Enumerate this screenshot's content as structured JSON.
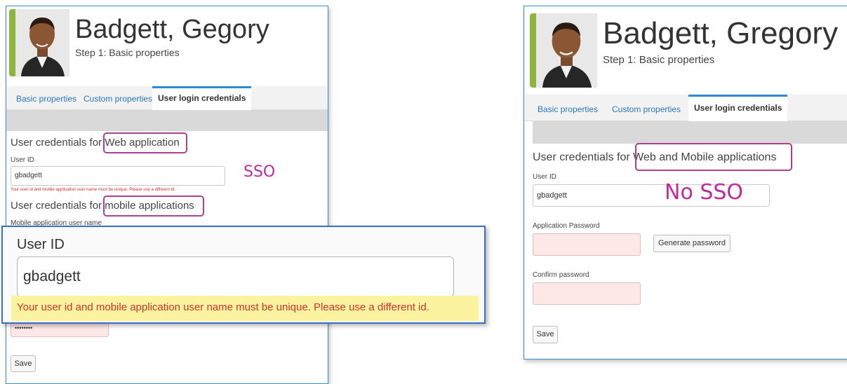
{
  "left_panel": {
    "name": "Badgett, Gegory",
    "step": "Step 1: Basic properties",
    "tabs": [
      "Basic properties",
      "Custom properties",
      "User login credentials"
    ],
    "web_section_prefix": "User credentials for",
    "web_section_highlight": "Web application",
    "user_id_label": "User ID",
    "user_id_value": "gbadgett",
    "error_text": "Your user id and mobile application user name must be unique. Please use a different id.",
    "mobile_section_prefix": "User credentials for",
    "mobile_section_highlight": "mobile applications",
    "mobile_user_label": "Mobile application user name",
    "password_value": "••••••••",
    "save_label": "Save",
    "annotation": "SSO"
  },
  "zoom_callout": {
    "user_id_label": "User ID",
    "user_id_value": "gbadgett",
    "error_text": "Your user id and mobile application user name must be unique. Please use a different id."
  },
  "right_panel": {
    "name": "Badgett, Gregory",
    "step": "Step 1: Basic properties",
    "tabs": [
      "Basic properties",
      "Custom properties",
      "User login credentials"
    ],
    "section_prefix": "User credentials for",
    "section_highlight": "Web and Mobile applications",
    "user_id_label": "User ID",
    "user_id_value": "gbadgett",
    "app_password_label": "Application Password",
    "generate_label": "Generate password",
    "confirm_label": "Confirm password",
    "save_label": "Save",
    "annotation": "No SSO"
  },
  "colors": {
    "accent_blue": "#2b8ad2",
    "highlight_purple": "#b0408f",
    "error_red": "#d0332d",
    "annotation_magenta": "#c02a9b",
    "error_highlight_yellow": "#fbf3a0"
  }
}
